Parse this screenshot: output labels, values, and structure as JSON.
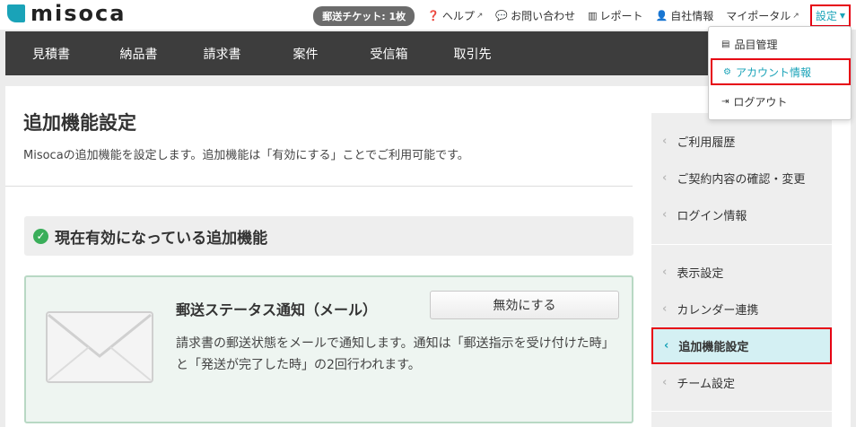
{
  "header": {
    "logo_text": "misoca",
    "ticket_badge": "郵送チケット: 1枚",
    "nav": [
      {
        "label": "ヘルプ",
        "icon": "question-circle-icon"
      },
      {
        "label": "お問い合わせ",
        "icon": "comment-icon"
      },
      {
        "label": "レポート",
        "icon": "bar-chart-icon"
      },
      {
        "label": "自社情報",
        "icon": "user-icon"
      },
      {
        "label": "マイポータル",
        "icon": "external-link-icon"
      }
    ],
    "settings_label": "設定"
  },
  "main_nav": {
    "tabs": [
      "見積書",
      "納品書",
      "請求書",
      "案件",
      "受信箱",
      "取引先"
    ]
  },
  "page": {
    "title": "追加機能設定",
    "description": "Misocaの追加機能を設定します。追加機能は「有効にする」ことでご利用可能です。",
    "section_title": "現在有効になっている追加機能"
  },
  "feature": {
    "title": "郵送ステータス通知（メール）",
    "button_label": "無効にする",
    "description": "請求書の郵送状態をメールで通知します。通知は「郵送指示を受け付けた時」と「発送が完了した時」の2回行われます。"
  },
  "sidebar": {
    "items": [
      "ご利用履歴",
      "ご契約内容の確認・変更",
      "ログイン情報",
      "表示設定",
      "カレンダー連携",
      "追加機能設定",
      "チーム設定"
    ],
    "active": "追加機能設定"
  },
  "dropdown": {
    "items": [
      {
        "label": "品目管理",
        "icon": "list-icon"
      },
      {
        "label": "アカウント情報",
        "icon": "gear-icon"
      },
      {
        "label": "ログアウト",
        "icon": "sign-out-icon"
      }
    ]
  },
  "colors": {
    "accent": "#1aa3b8",
    "nav_bg": "#3d3d3d",
    "highlight_border": "#e60012",
    "success": "#3aae5a"
  }
}
